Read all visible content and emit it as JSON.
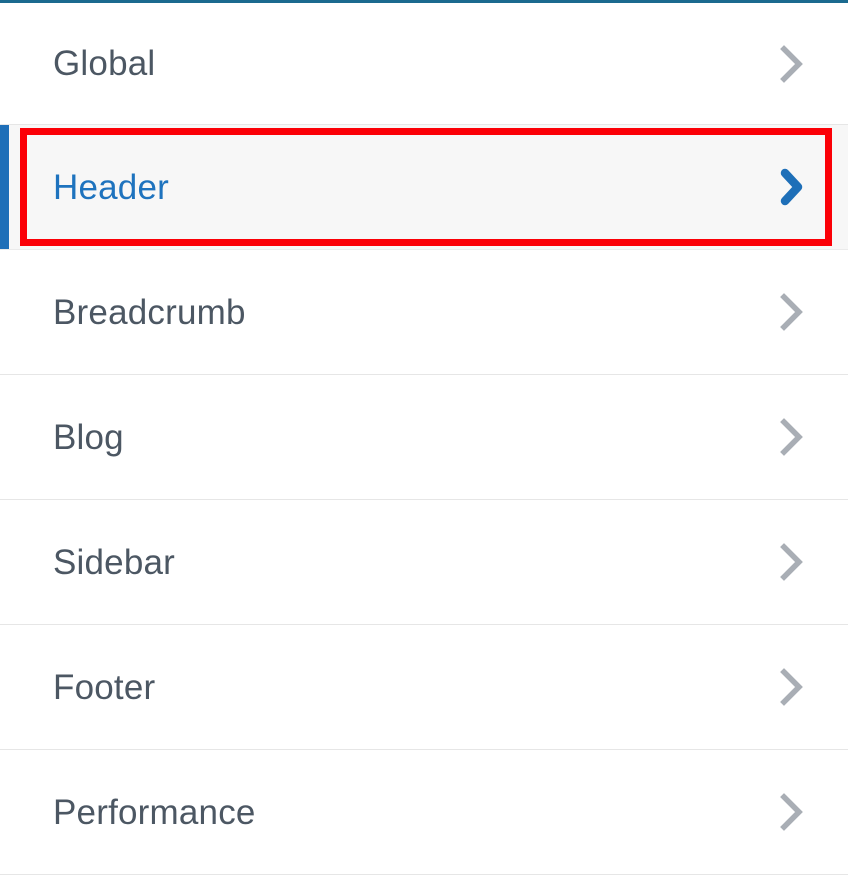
{
  "panel": {
    "top_rule_color": "#1b6a8f",
    "background_color": "#ffffff",
    "separator_color": "#e6e6e6"
  },
  "theme": {
    "label_color": "#4c5763",
    "active_label_color": "#1e73be",
    "active_bar_color": "#1e6fb8",
    "active_row_background": "#f7f7f7",
    "chevron_color": "#a9aeb5",
    "active_chevron_color": "#1e6fb8",
    "annotation_color": "#fb0007"
  },
  "menu": {
    "items": [
      {
        "label": "Global",
        "icon": "chevron-right-icon",
        "active": false
      },
      {
        "label": "Header",
        "icon": "chevron-right-icon",
        "active": true
      },
      {
        "label": "Breadcrumb",
        "icon": "chevron-right-icon",
        "active": false
      },
      {
        "label": "Blog",
        "icon": "chevron-right-icon",
        "active": false
      },
      {
        "label": "Sidebar",
        "icon": "chevron-right-icon",
        "active": false
      },
      {
        "label": "Footer",
        "icon": "chevron-right-icon",
        "active": false
      },
      {
        "label": "Performance",
        "icon": "chevron-right-icon",
        "active": false
      }
    ]
  },
  "annotation": {
    "target_label": "Header",
    "shape": "rectangle",
    "color": "#fb0007"
  }
}
